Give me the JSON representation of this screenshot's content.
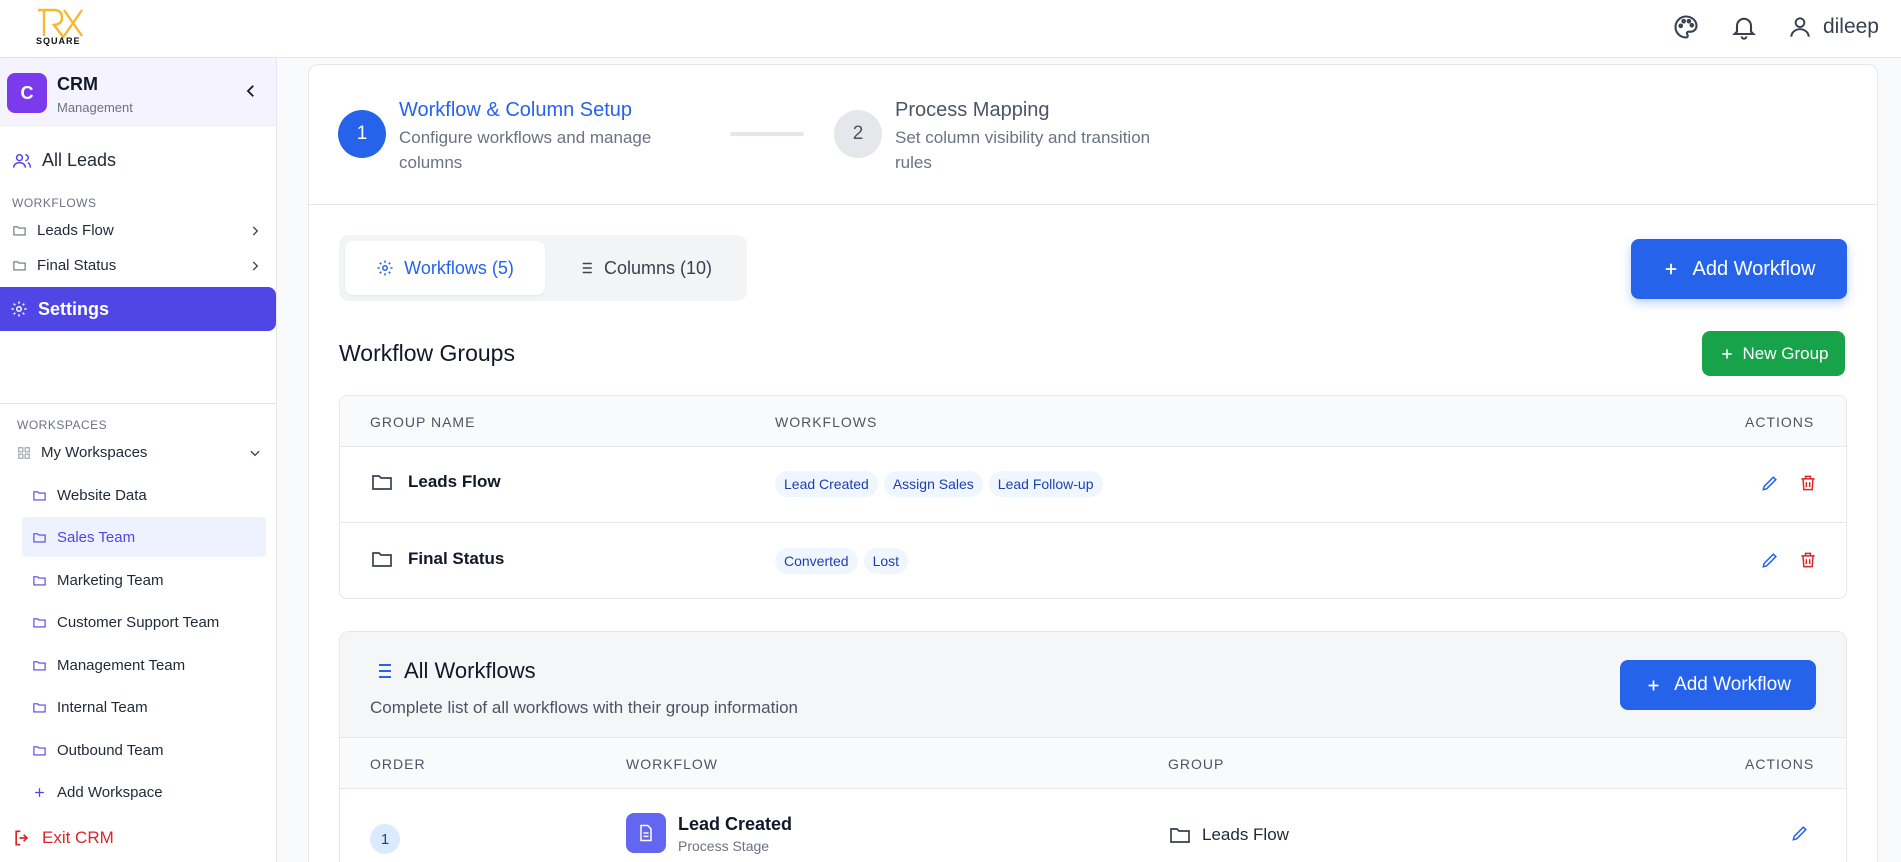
{
  "header": {
    "logo_text": "SQUARE",
    "user_name": "dileep",
    "icons": [
      "palette-icon",
      "bell-icon",
      "user-icon"
    ]
  },
  "sidebar": {
    "app_badge": "C",
    "app_title": "CRM",
    "app_subtitle": "Management",
    "all_leads": "All Leads",
    "workflows_label": "WORKFLOWS",
    "workflow_items": [
      {
        "label": "Leads Flow"
      },
      {
        "label": "Final Status"
      }
    ],
    "settings_label": "Settings",
    "workspaces_label": "WORKSPACES",
    "my_workspaces": "My Workspaces",
    "workspaces": [
      {
        "label": "Website Data"
      },
      {
        "label": "Sales Team",
        "active": true
      },
      {
        "label": "Marketing Team"
      },
      {
        "label": "Customer Support Team"
      },
      {
        "label": "Management Team"
      },
      {
        "label": "Internal Team"
      },
      {
        "label": "Outbound Team"
      }
    ],
    "add_workspace": "Add Workspace",
    "exit_label": "Exit CRM"
  },
  "stepper": {
    "steps": [
      {
        "number": "1",
        "title": "Workflow & Column Setup",
        "description": "Configure workflows and manage columns"
      },
      {
        "number": "2",
        "title": "Process Mapping",
        "description": "Set column visibility and transition rules"
      }
    ]
  },
  "tabs": [
    {
      "label": "Workflows (5)"
    },
    {
      "label": "Columns (10)"
    }
  ],
  "buttons": {
    "add_workflow": "Add Workflow",
    "new_group": "New Group"
  },
  "groups": {
    "title": "Workflow Groups",
    "headers": {
      "name": "GROUP NAME",
      "workflows": "WORKFLOWS",
      "actions": "ACTIONS"
    },
    "rows": [
      {
        "name": "Leads Flow",
        "workflows": [
          "Lead Created",
          "Assign Sales",
          "Lead Follow-up"
        ]
      },
      {
        "name": "Final Status",
        "workflows": [
          "Converted",
          "Lost"
        ]
      }
    ]
  },
  "all_workflows": {
    "title": "All Workflows",
    "subtitle": "Complete list of all workflows with their group information",
    "headers": {
      "order": "ORDER",
      "workflow": "WORKFLOW",
      "group": "GROUP",
      "actions": "ACTIONS"
    },
    "rows": [
      {
        "order": "1",
        "name": "Lead Created",
        "type": "Process Stage",
        "group": "Leads Flow"
      }
    ]
  },
  "colors": {
    "primary": "#2563eb",
    "sidebar_active": "#4f46e5",
    "success": "#16a34a",
    "danger": "#dc2626",
    "badge": "#7c3aed"
  }
}
